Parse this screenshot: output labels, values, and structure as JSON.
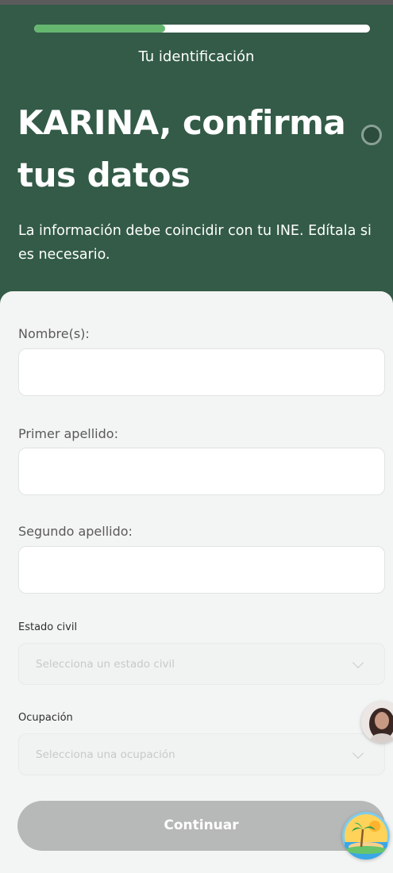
{
  "header": {
    "progress_fraction": 0.39,
    "step_title": "Tu identificación",
    "title": "KARINA, confirma tus datos",
    "subtitle": "La información debe coincidir con tu INE. Edítala si es necesario."
  },
  "form": {
    "nombre": {
      "label": "Nombre(s):",
      "value": ""
    },
    "primer_apellido": {
      "label": "Primer apellido:",
      "value": ""
    },
    "segundo_apellido": {
      "label": "Segundo apellido:",
      "value": ""
    },
    "estado_civil": {
      "label": "Estado civil",
      "placeholder": "Selecciona un estado civil"
    },
    "ocupacion": {
      "label": "Ocupación",
      "placeholder": "Selecciona una ocupación"
    }
  },
  "actions": {
    "continue_label": "Continuar"
  },
  "floating": {
    "avatar_icon": "assistant-avatar-icon",
    "beach_icon": "beach-island-icon"
  },
  "colors": {
    "header_green": "#335b47",
    "progress_green": "#65b770",
    "button_disabled": "#b7b9b8",
    "sheet_bg": "#f3f4f4"
  }
}
